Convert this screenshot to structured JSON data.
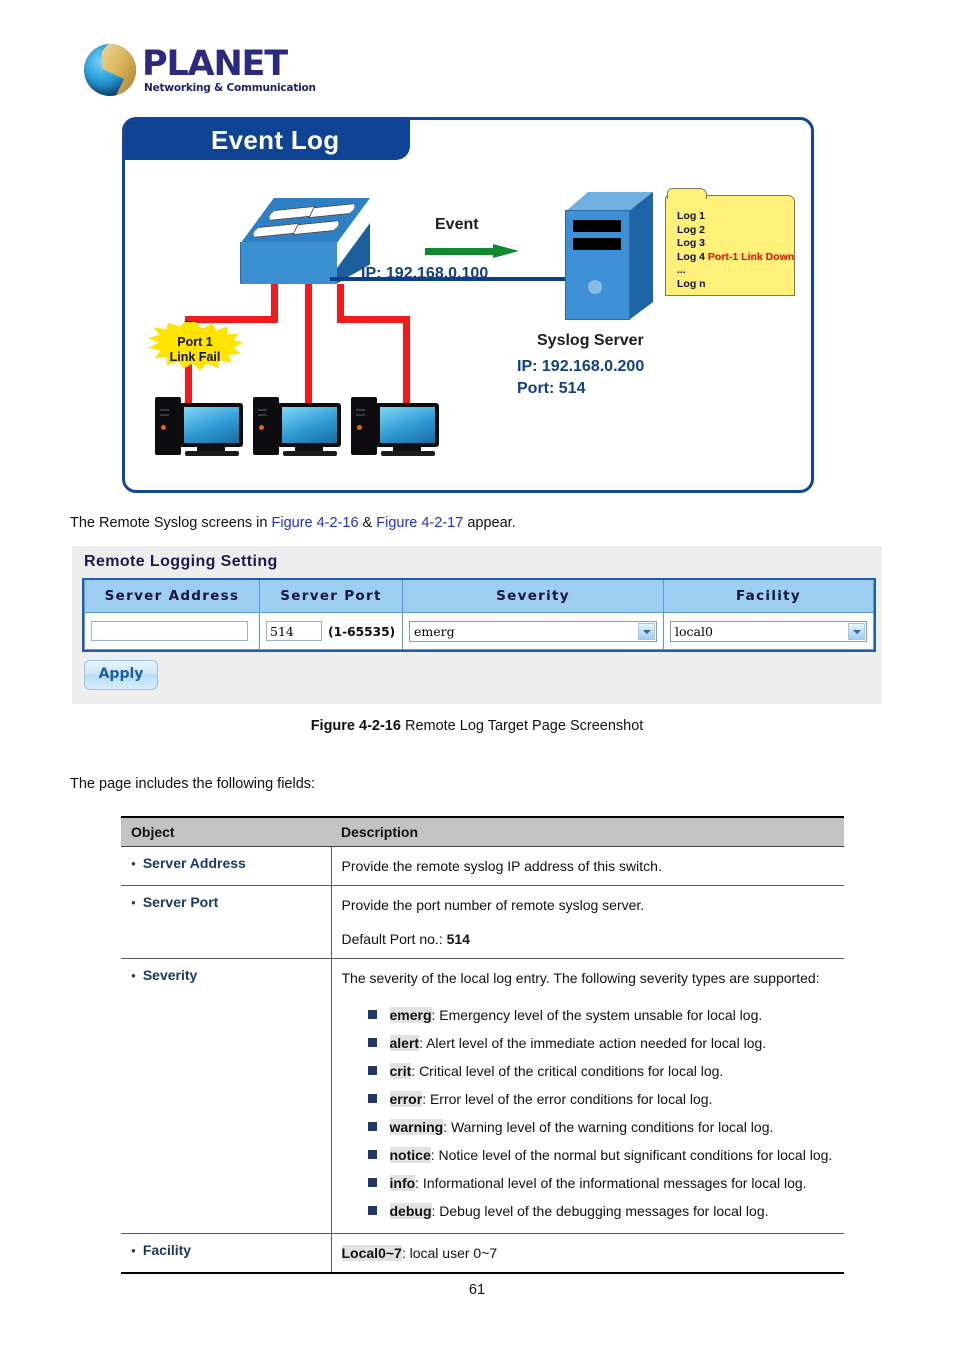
{
  "brand": {
    "name": "PLANET",
    "tagline": "Networking & Communication"
  },
  "diagram": {
    "title": "Event Log",
    "event_label": "Event",
    "switch_ip": "IP: 192.168.0.100",
    "server_caption": "Syslog Server",
    "server_ip": "IP: 192.168.0.200",
    "server_port": "Port: 514",
    "alert_line1": "Port 1",
    "alert_line2": "Link Fail",
    "log_lines": [
      "Log 1",
      "Log 2",
      "Log 3"
    ],
    "log_line4_prefix": "Log 4",
    "log_line4_event": "Port-1 Link Down",
    "log_ellipsis": "...",
    "log_last": "Log n"
  },
  "intro": {
    "prefix": "The Remote Syslog screens in ",
    "figure_a": "Figure 4-2-16",
    "amp": " & ",
    "figure_b": "Figure 4-2-17",
    "suffix": " appear."
  },
  "panel": {
    "title": "Remote Logging Setting",
    "headers": [
      "Server Address",
      "Server Port",
      "Severity",
      "Facility"
    ],
    "server_address_value": "",
    "server_port_value": "514",
    "server_port_range": "(1-65535)",
    "severity_value": "emerg",
    "facility_value": "local0",
    "apply_label": "Apply"
  },
  "caption": {
    "bold": "Figure 4-2-16",
    "rest": " Remote Log Target Page Screenshot"
  },
  "fields_intro": "The page includes the following fields:",
  "fields_table": {
    "headers": [
      "Object",
      "Description"
    ],
    "rows": [
      {
        "object": "Server Address",
        "paragraphs": [
          "Provide the remote syslog IP address of this switch."
        ]
      },
      {
        "object": "Server Port",
        "paragraphs": [
          "Provide the port number of remote syslog server."
        ],
        "default_label": "Default Port no.: ",
        "default_value": "514"
      },
      {
        "object": "Severity",
        "paragraphs": [
          "The severity of the local log entry. The following severity types are supported:"
        ],
        "items": [
          {
            "term": "emerg",
            "text": ": Emergency level of the system unsable for local log."
          },
          {
            "term": "alert",
            "text": ": Alert level of the immediate action needed for local log."
          },
          {
            "term": "crit",
            "text": ": Critical level of the critical conditions for local log."
          },
          {
            "term": "error",
            "text": ": Error level of the error conditions for local log."
          },
          {
            "term": "warning",
            "text": ": Warning level of the warning conditions for local log."
          },
          {
            "term": "notice",
            "text": ": Notice level of the normal but significant conditions for local log."
          },
          {
            "term": "info",
            "text": ": Informational level of the informational messages for local log."
          },
          {
            "term": "debug",
            "text": ": Debug level of the debugging messages for local log."
          }
        ]
      },
      {
        "object": "Facility",
        "term": "Local0~7",
        "term_text": ": local user 0~7"
      }
    ]
  },
  "page_number": "61",
  "colors": {
    "brand_blue": "#2c2a80",
    "diagram_border": "#12479c",
    "title_bar": "#0f4494",
    "cable_red": "#ee1c1c",
    "arrow_green": "#12892f",
    "note_yellow": "#fff07a",
    "burst_yellow": "#ffe400",
    "event_red": "#ff0000",
    "header_blue": "#9ecdf2",
    "link_blue": "#2030d8",
    "object_text": "#1b3a63"
  }
}
